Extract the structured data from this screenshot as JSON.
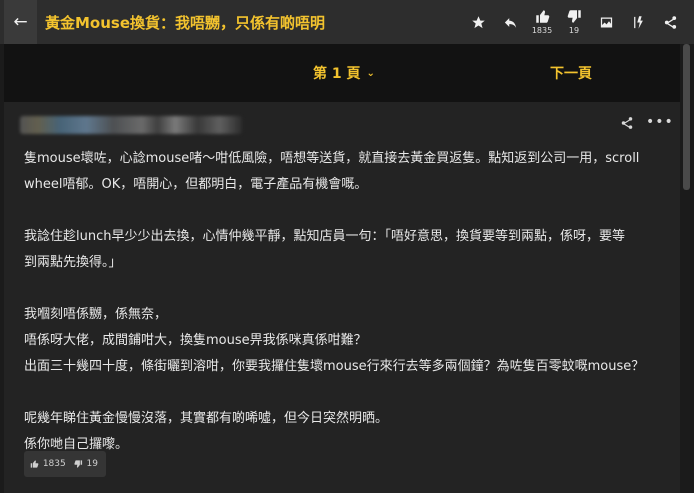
{
  "topbar": {
    "title": "黃金Mouse換貨：我唔嬲，只係有啲唔明",
    "like_count": "1835",
    "dislike_count": "19"
  },
  "pagebar": {
    "page_label": "第 1 頁",
    "next_label": "下一頁"
  },
  "post": {
    "paragraphs": [
      [
        "隻mouse壞咗，心諗mouse啫～咁低風險，唔想等送貨，就直接去黃金買返隻。點知返到公司一用，scroll",
        "wheel唔郁。OK，唔開心，但都明白，電子產品有機會嘅。"
      ],
      [
        "我諗住趁lunch早少少出去換，心情仲幾平靜，點知店員一句：「唔好意思，換貨要等到兩點，係呀，要等",
        "到兩點先換得。」"
      ],
      [
        "我嗰刻唔係嬲，係無奈，",
        "唔係呀大佬，成間鋪咁大，換隻mouse畀我係咪真係咁難？",
        "出面三十幾四十度，條街曬到溶咁，你要我攞住隻壞mouse行來行去等多兩個鐘？為咗隻百零蚊嘅mouse？"
      ],
      [
        "呢幾年睇住黃金慢慢沒落，其實都有啲唏噓，但今日突然明晒。",
        "係你哋自己攞嚟。"
      ]
    ],
    "like_count": "1835",
    "dislike_count": "19"
  },
  "icons": {
    "back": "back-arrow-icon",
    "star": "star-icon",
    "reply": "reply-icon",
    "like": "thumbs-up-icon",
    "dislike": "thumbs-down-icon",
    "image": "image-icon",
    "filter": "filter-icon",
    "share": "share-icon",
    "more": "more-icon",
    "dropdown": "chevron-down-icon"
  },
  "colors": {
    "accent": "#f3c32e",
    "topbar_bg": "#2d2d2d",
    "page_bg": "#1b1b1b",
    "post_bg": "#232323"
  }
}
